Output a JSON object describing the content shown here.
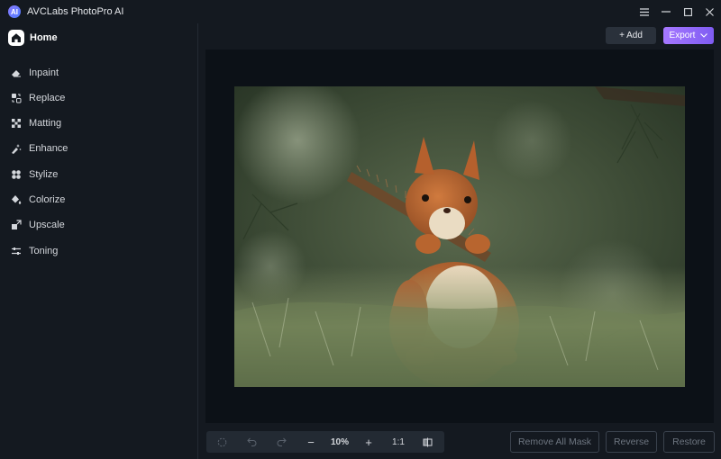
{
  "titlebar": {
    "logo_text": "AI",
    "title": "AVCLabs PhotoPro AI",
    "menu_icon": "hamburger-icon",
    "minimize_icon": "minimize-icon",
    "maximize_icon": "maximize-icon",
    "close_icon": "close-icon"
  },
  "sidebar": {
    "home": {
      "label": "Home",
      "icon": "home-icon"
    },
    "items": [
      {
        "label": "Inpaint",
        "icon": "eraser-icon"
      },
      {
        "label": "Replace",
        "icon": "replace-icon"
      },
      {
        "label": "Matting",
        "icon": "matting-icon"
      },
      {
        "label": "Enhance",
        "icon": "enhance-icon"
      },
      {
        "label": "Stylize",
        "icon": "stylize-icon"
      },
      {
        "label": "Colorize",
        "icon": "colorize-icon"
      },
      {
        "label": "Upscale",
        "icon": "upscale-icon"
      },
      {
        "label": "Toning",
        "icon": "toning-icon"
      }
    ]
  },
  "header": {
    "add_label": "+ Add",
    "export_label": "Export"
  },
  "toolbar": {
    "zoom_value": "10%",
    "actual_size_label": "1:1",
    "zoom_out_label": "−",
    "zoom_in_label": "+"
  },
  "actions": {
    "remove_all_mask": "Remove All Mask",
    "reverse": "Reverse",
    "restore": "Restore"
  },
  "colors": {
    "accent": "#9b6cff",
    "background": "#141920",
    "canvas": "#0c1117"
  }
}
